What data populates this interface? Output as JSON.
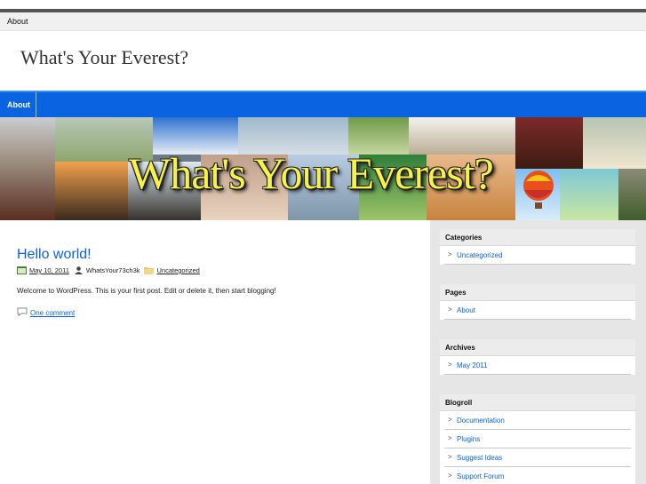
{
  "topnav": {
    "about": "About"
  },
  "site": {
    "title": "What's Your Everest?"
  },
  "menubar": {
    "about": "About"
  },
  "banner": {
    "title": "What's Your Everest?"
  },
  "post": {
    "title": "Hello world!",
    "date": "May 10, 2011",
    "author": "WhatsYour73ch3k",
    "category": "Uncategorized",
    "body": "Welcome to WordPress. This is your first post. Edit or delete it, then start blogging!",
    "comments": "One comment"
  },
  "sidebar": {
    "categories": {
      "heading": "Categories",
      "items": [
        "Uncategorized"
      ]
    },
    "pages": {
      "heading": "Pages",
      "items": [
        "About"
      ]
    },
    "archives": {
      "heading": "Archives",
      "items": [
        "May 2011"
      ]
    },
    "blogroll": {
      "heading": "Blogroll",
      "items": [
        "Documentation",
        "Plugins",
        "Suggest Ideas",
        "Support Forum"
      ]
    }
  },
  "colors": {
    "accent": "#0a63e0",
    "banner_text": "#f7f24a",
    "sidebar_bg": "#e6e6e6"
  }
}
